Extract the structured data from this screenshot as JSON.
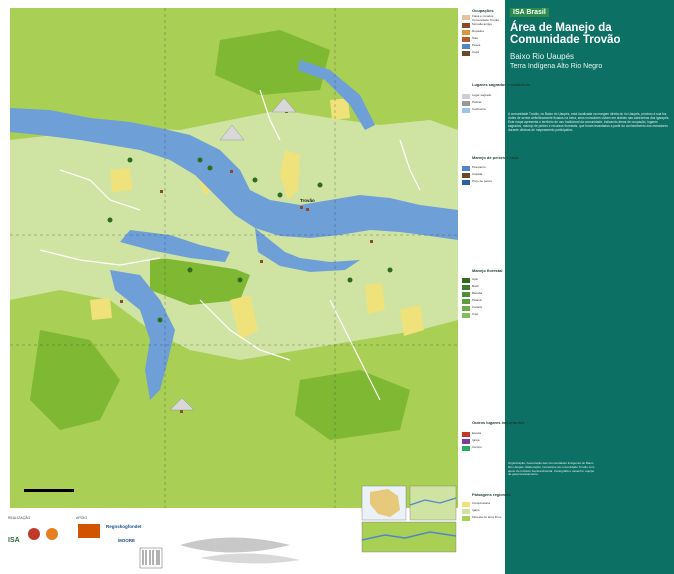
{
  "colors": {
    "river": "#6e9fd6",
    "river_dark": "#4f86c8",
    "forest_light": "#cfe4a3",
    "forest_mid": "#a9cf54",
    "forest_dark": "#7fb832",
    "vegetation_yellow": "#f0e27a",
    "panel_teal": "#0d7064",
    "road": "#ffffff"
  },
  "panel": {
    "brand": "ISA Brasil",
    "title": "Área de Manejo da Comunidade Trovão",
    "subtitle": "Baixo Rio Uaupés",
    "subtitle2": "Terra Indígena Alto Rio Negro",
    "body_intro": "A comunidade Trovão, no Baixo rio Uaupés, está localizada na margem direita do rio Uaupés, próximo à sua foz. Antes de serem definitivamente fixados na beira, seus moradores viviam em aldeias nas cabeceiras dos igarapés. Este mapa apresenta o território de uso tradicional da comunidade, indicando áreas de ocupação, lugares sagrados, manejo de peixes e recursos florestais, que foram levantados a partir do conhecimento dos moradores durante oficinas de mapeamento participativo.",
    "credits": "Organização: Associação das Comunidades Indígenas do Baixo Rio Uaupés. Elaboração: moradores da comunidade Trovão com apoio do Instituto Socioambiental. Cartografia e desenho: equipe de geoprocessamento."
  },
  "map": {
    "place_trovao": "Trovão"
  },
  "legend": {
    "section_ocupacoes": "Ocupações",
    "ocupacoes": [
      "Faixa e roçados Comunidade Trovão",
      "Moradia antiga",
      "Roçados",
      "Sítio",
      "Pesca",
      "Caça"
    ],
    "section_sagrados": "Lugares sagrados e históricos",
    "sagrados": [
      "Lugar sagrado",
      "Pedras",
      "Cachoeira"
    ],
    "section_manejo": "Manejo de peixes e caça",
    "manejo": [
      "Pesqueiro",
      "Caçada",
      "Poço de pesca"
    ],
    "section_florestal": "Manejo florestal",
    "florestal": [
      "Açaí",
      "Buriti",
      "Bacaba",
      "Patauá",
      "Caranã",
      "Cipó"
    ],
    "section_outros": "Outros lugares importantes",
    "outros": [
      "Escola",
      "Igreja",
      "Campo"
    ],
    "section_paisagens": "Paisagens regionais",
    "paisagens": [
      "Campinarana",
      "Igapó",
      "Floresta de terra firme"
    ]
  },
  "footer": {
    "label_realizacao": "REALIZAÇÃO",
    "label_apoio": "APOIO",
    "logo_isa": "ISA",
    "logo_regnorg": "Regnskogfondet",
    "logo_moore": "MOORE"
  }
}
